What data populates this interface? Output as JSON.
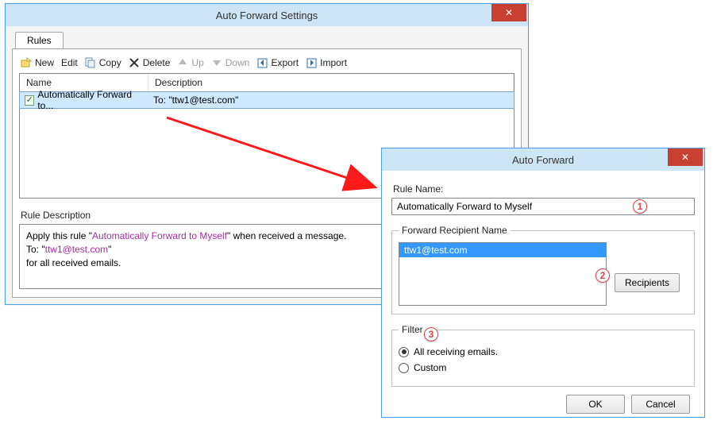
{
  "settingsWindow": {
    "title": "Auto Forward Settings",
    "tab": "Rules",
    "toolbar": {
      "new": "New",
      "edit": "Edit",
      "copy": "Copy",
      "delete": "Delete",
      "up": "Up",
      "down": "Down",
      "export": "Export",
      "import": "Import"
    },
    "columns": {
      "name": "Name",
      "description": "Description"
    },
    "rows": [
      {
        "checked": true,
        "name": "Automatically Forward to...",
        "description": "To: \"ttw1@test.com\""
      }
    ],
    "ruleDescriptionLabel": "Rule Description",
    "ruleDescription": {
      "line1_a": "Apply this rule \"",
      "line1_link": "Automatically Forward to Myself",
      "line1_b": "\" when received a message.",
      "line2_a": "To: \"",
      "line2_link": "ttw1@test.com",
      "line2_b": "\"",
      "line3": "for all received emails."
    }
  },
  "forwardWindow": {
    "title": "Auto Forward",
    "ruleNameLabel": "Rule Name:",
    "ruleName": "Automatically Forward to Myself",
    "recipientGroup": "Forward Recipient Name",
    "recipient": "ttw1@test.com",
    "recipientsBtn": "Recipients",
    "filterGroup": "Filter",
    "filterAll": "All receiving emails.",
    "filterCustom": "Custom",
    "ok": "OK",
    "cancel": "Cancel"
  },
  "callouts": {
    "c1": "1",
    "c2": "2",
    "c3": "3"
  }
}
